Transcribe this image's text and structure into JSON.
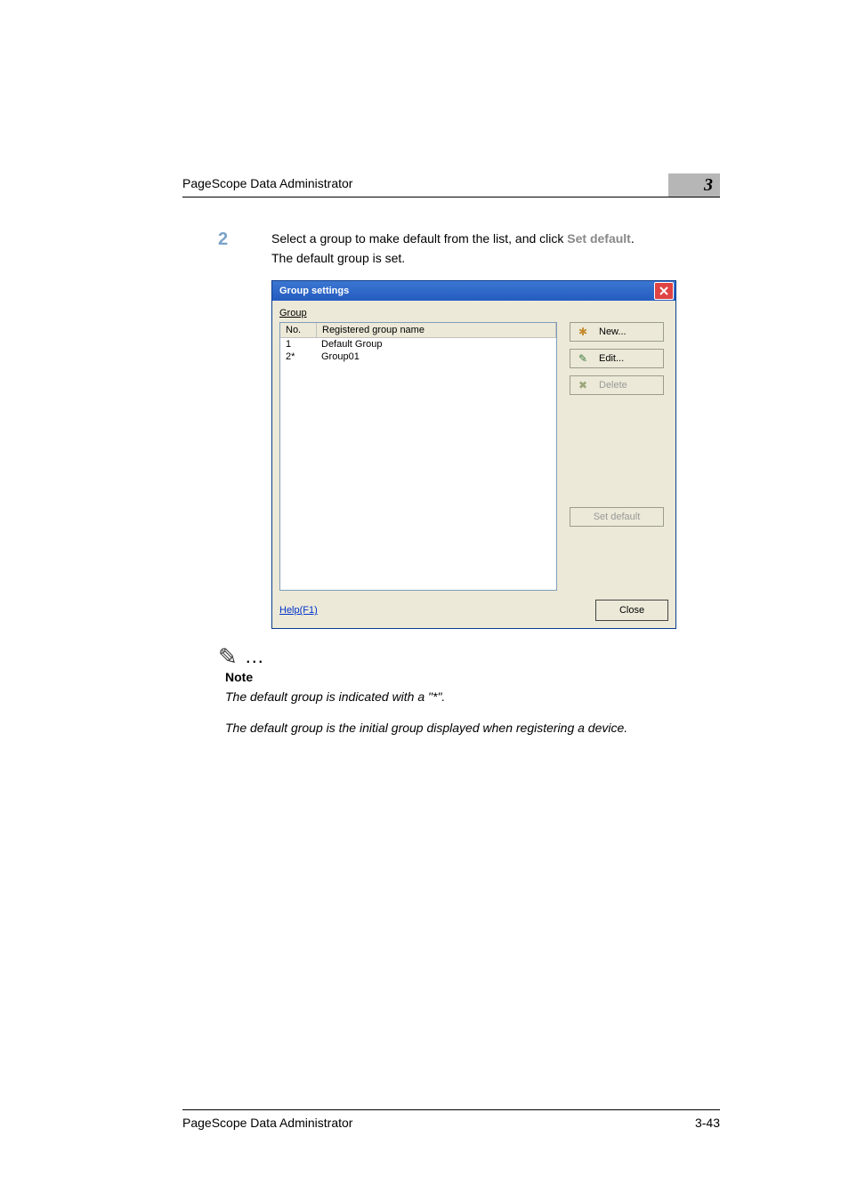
{
  "header": {
    "title": "PageScope Data Administrator",
    "chapter": "3"
  },
  "step": {
    "number": "2",
    "line1_a": "Select a group to make default from the list, and click ",
    "line1_b": "Set default",
    "line1_c": ".",
    "line2": "The default group is set."
  },
  "dialog": {
    "title": "Group settings",
    "group_label": "Group",
    "columns": {
      "no": "No.",
      "name": "Registered group name"
    },
    "rows": [
      {
        "no": "1",
        "name": "Default Group"
      },
      {
        "no": "2*",
        "name": "Group01"
      }
    ],
    "buttons": {
      "new": "New...",
      "edit": "Edit...",
      "delete": "Delete",
      "set_default": "Set default"
    },
    "help": "Help(F1)",
    "close": "Close"
  },
  "note": {
    "label": "Note",
    "line1": "The default group is indicated with a \"*\".",
    "line2": "The default group is the initial group displayed when registering a device."
  },
  "footer": {
    "left": "PageScope Data Administrator",
    "right": "3-43"
  }
}
